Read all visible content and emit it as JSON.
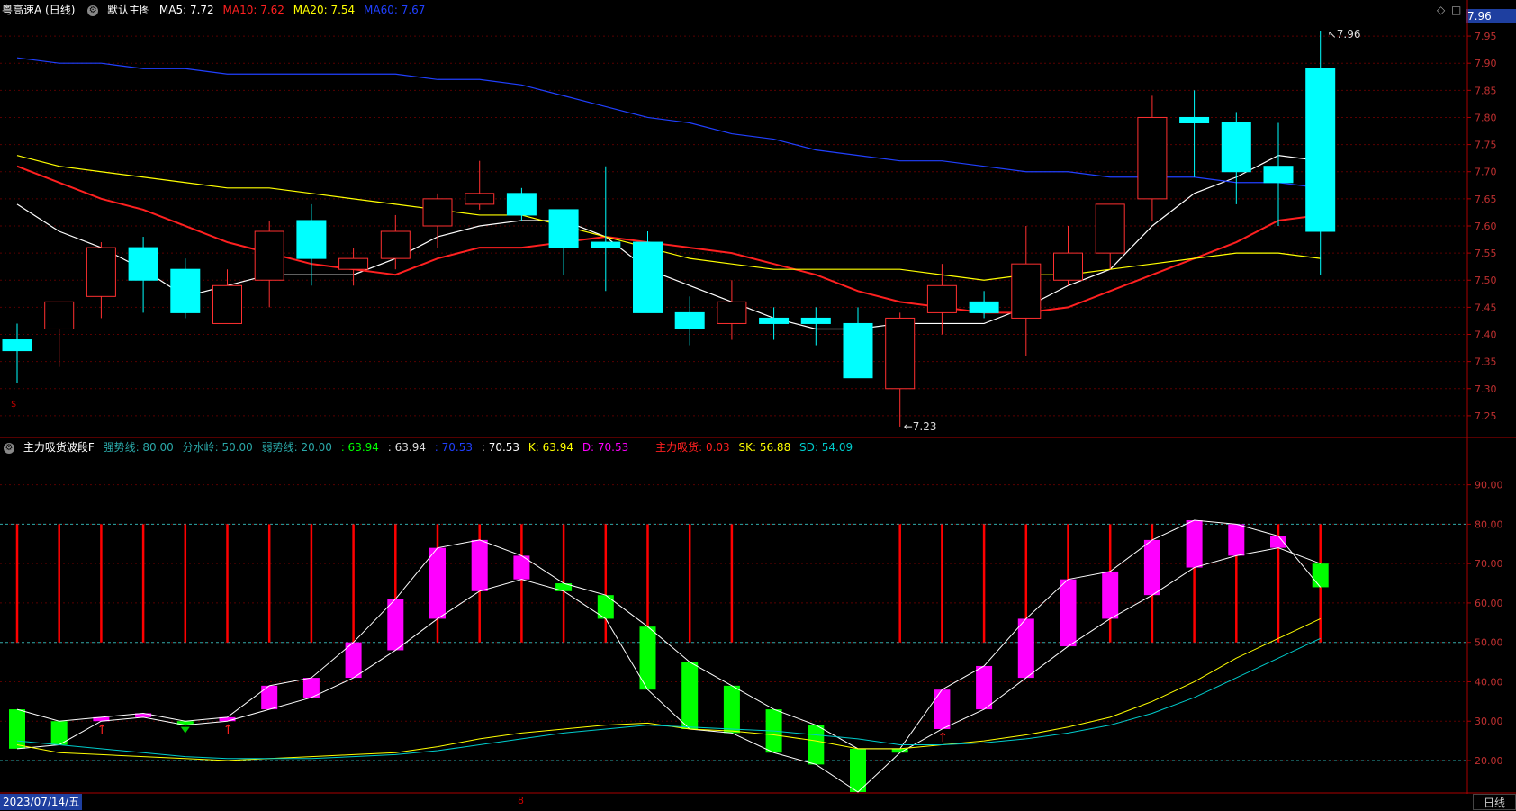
{
  "header": {
    "symbol": "粤高速A (日线)",
    "main_chart_label": "默认主图",
    "ma": [
      {
        "label": "MA5: 7.72",
        "color": "#ffffff"
      },
      {
        "label": "MA10: 7.62",
        "color": "#ff2020"
      },
      {
        "label": "MA20: 7.54",
        "color": "#ffff00"
      },
      {
        "label": "MA60: 7.67",
        "color": "#2040ff"
      }
    ],
    "current_price": "7.96"
  },
  "indicator_header": {
    "name": "主力吸货波段F",
    "items": [
      {
        "label": "强势线: 80.00",
        "color": "#2aa8a8"
      },
      {
        "label": "分水岭: 50.00",
        "color": "#2aa8a8"
      },
      {
        "label": "弱势线: 20.00",
        "color": "#2aa8a8"
      },
      {
        "label": ": 63.94",
        "color": "#00ff00"
      },
      {
        "label": ": 63.94",
        "color": "#dddddd"
      },
      {
        "label": ": 70.53",
        "color": "#2040ff"
      },
      {
        "label": ": 70.53",
        "color": "#ffffff"
      },
      {
        "label": "K: 63.94",
        "color": "#ffff00"
      },
      {
        "label": "D: 70.53",
        "color": "#ff00ff"
      },
      {
        "label": "主力吸货: 0.03",
        "color": "#ff2020"
      },
      {
        "label": "SK: 56.88",
        "color": "#ffff00"
      },
      {
        "label": "SD: 54.09",
        "color": "#00cccc"
      }
    ]
  },
  "footer": {
    "date": "2023/07/14/五",
    "cycle": "日线",
    "marker": "8"
  },
  "chart_data": [
    {
      "type": "candlestick",
      "title": "粤高速A (日线)",
      "y_ticks": [
        "7.95",
        "7.90",
        "7.85",
        "7.80",
        "7.75",
        "7.70",
        "7.65",
        "7.60",
        "7.55",
        "7.50",
        "7.45",
        "7.40",
        "7.35",
        "7.30",
        "7.25"
      ],
      "ylim": [
        7.21,
        7.98
      ],
      "annotations": {
        "high": "7.96",
        "low": "7.23"
      },
      "candles": [
        {
          "o": 7.39,
          "h": 7.42,
          "l": 7.31,
          "c": 7.37
        },
        {
          "o": 7.41,
          "h": 7.46,
          "l": 7.34,
          "c": 7.46
        },
        {
          "o": 7.47,
          "h": 7.57,
          "l": 7.43,
          "c": 7.56
        },
        {
          "o": 7.56,
          "h": 7.58,
          "l": 7.44,
          "c": 7.5
        },
        {
          "o": 7.52,
          "h": 7.54,
          "l": 7.43,
          "c": 7.44
        },
        {
          "o": 7.42,
          "h": 7.52,
          "l": 7.42,
          "c": 7.49
        },
        {
          "o": 7.5,
          "h": 7.61,
          "l": 7.45,
          "c": 7.59
        },
        {
          "o": 7.61,
          "h": 7.64,
          "l": 7.49,
          "c": 7.54
        },
        {
          "o": 7.52,
          "h": 7.56,
          "l": 7.49,
          "c": 7.54
        },
        {
          "o": 7.54,
          "h": 7.62,
          "l": 7.52,
          "c": 7.59
        },
        {
          "o": 7.6,
          "h": 7.66,
          "l": 7.56,
          "c": 7.65
        },
        {
          "o": 7.64,
          "h": 7.72,
          "l": 7.63,
          "c": 7.66
        },
        {
          "o": 7.66,
          "h": 7.67,
          "l": 7.61,
          "c": 7.62
        },
        {
          "o": 7.63,
          "h": 7.63,
          "l": 7.51,
          "c": 7.56
        },
        {
          "o": 7.57,
          "h": 7.71,
          "l": 7.48,
          "c": 7.56
        },
        {
          "o": 7.57,
          "h": 7.59,
          "l": 7.44,
          "c": 7.44
        },
        {
          "o": 7.44,
          "h": 7.47,
          "l": 7.38,
          "c": 7.41
        },
        {
          "o": 7.42,
          "h": 7.5,
          "l": 7.39,
          "c": 7.46
        },
        {
          "o": 7.43,
          "h": 7.45,
          "l": 7.39,
          "c": 7.42
        },
        {
          "o": 7.43,
          "h": 7.45,
          "l": 7.38,
          "c": 7.42
        },
        {
          "o": 7.42,
          "h": 7.45,
          "l": 7.32,
          "c": 7.32
        },
        {
          "o": 7.3,
          "h": 7.44,
          "l": 7.23,
          "c": 7.43
        },
        {
          "o": 7.44,
          "h": 7.53,
          "l": 7.4,
          "c": 7.49
        },
        {
          "o": 7.46,
          "h": 7.48,
          "l": 7.43,
          "c": 7.44
        },
        {
          "o": 7.43,
          "h": 7.6,
          "l": 7.36,
          "c": 7.53
        },
        {
          "o": 7.5,
          "h": 7.6,
          "l": 7.49,
          "c": 7.55
        },
        {
          "o": 7.55,
          "h": 7.64,
          "l": 7.52,
          "c": 7.64
        },
        {
          "o": 7.65,
          "h": 7.84,
          "l": 7.61,
          "c": 7.8
        },
        {
          "o": 7.8,
          "h": 7.85,
          "l": 7.69,
          "c": 7.79
        },
        {
          "o": 7.79,
          "h": 7.81,
          "l": 7.64,
          "c": 7.7
        },
        {
          "o": 7.71,
          "h": 7.79,
          "l": 7.6,
          "c": 7.68
        },
        {
          "o": 7.89,
          "h": 7.96,
          "l": 7.51,
          "c": 7.59
        }
      ],
      "lines": [
        {
          "name": "MA5",
          "color": "#ffffff",
          "values": [
            7.64,
            7.59,
            7.56,
            7.52,
            7.47,
            7.49,
            7.51,
            7.51,
            7.51,
            7.54,
            7.58,
            7.6,
            7.61,
            7.61,
            7.58,
            7.52,
            7.49,
            7.46,
            7.43,
            7.41,
            7.41,
            7.42,
            7.42,
            7.42,
            7.45,
            7.49,
            7.52,
            7.6,
            7.66,
            7.69,
            7.73,
            7.72
          ]
        },
        {
          "name": "MA10",
          "color": "#ff2020",
          "values": [
            7.71,
            7.68,
            7.65,
            7.63,
            7.6,
            7.57,
            7.55,
            7.53,
            7.52,
            7.51,
            7.54,
            7.56,
            7.56,
            7.57,
            7.58,
            7.57,
            7.56,
            7.55,
            7.53,
            7.51,
            7.48,
            7.46,
            7.45,
            7.44,
            7.44,
            7.45,
            7.48,
            7.51,
            7.54,
            7.57,
            7.61,
            7.62
          ]
        },
        {
          "name": "MA20",
          "color": "#ffff00",
          "values": [
            7.73,
            7.71,
            7.7,
            7.69,
            7.68,
            7.67,
            7.67,
            7.66,
            7.65,
            7.64,
            7.63,
            7.62,
            7.62,
            7.6,
            7.58,
            7.56,
            7.54,
            7.53,
            7.52,
            7.52,
            7.52,
            7.52,
            7.51,
            7.5,
            7.51,
            7.51,
            7.52,
            7.53,
            7.54,
            7.55,
            7.55,
            7.54
          ]
        },
        {
          "name": "MA60",
          "color": "#2040ff",
          "values": [
            7.91,
            7.9,
            7.9,
            7.89,
            7.89,
            7.88,
            7.88,
            7.88,
            7.88,
            7.88,
            7.87,
            7.87,
            7.86,
            7.84,
            7.82,
            7.8,
            7.79,
            7.77,
            7.76,
            7.74,
            7.73,
            7.72,
            7.72,
            7.71,
            7.7,
            7.7,
            7.69,
            7.69,
            7.69,
            7.68,
            7.68,
            7.67
          ]
        }
      ]
    },
    {
      "type": "bar",
      "title": "主力吸货波段F",
      "y_ticks": [
        "90.00",
        "80.00",
        "70.00",
        "60.00",
        "50.00",
        "40.00",
        "30.00",
        "20.00"
      ],
      "ylim": [
        12,
        97
      ],
      "reference_lines": [
        80,
        50,
        20
      ],
      "bars": [
        {
          "top": 33,
          "bottom": 23,
          "up": false
        },
        {
          "top": 30,
          "bottom": 24,
          "up": false
        },
        {
          "top": 31,
          "bottom": 30,
          "up": true,
          "arrow": true
        },
        {
          "top": 32,
          "bottom": 31,
          "up": true
        },
        {
          "top": 30,
          "bottom": 29,
          "up": false,
          "arrow": true
        },
        {
          "top": 31,
          "bottom": 30,
          "up": true,
          "arrow": true
        },
        {
          "top": 39,
          "bottom": 33,
          "up": true
        },
        {
          "top": 41,
          "bottom": 36,
          "up": true
        },
        {
          "top": 50,
          "bottom": 41,
          "up": true
        },
        {
          "top": 61,
          "bottom": 48,
          "up": true
        },
        {
          "top": 74,
          "bottom": 56,
          "up": true
        },
        {
          "top": 76,
          "bottom": 63,
          "up": true
        },
        {
          "top": 72,
          "bottom": 66,
          "up": true
        },
        {
          "top": 65,
          "bottom": 63,
          "up": false
        },
        {
          "top": 62,
          "bottom": 56,
          "up": false
        },
        {
          "top": 54,
          "bottom": 38,
          "up": false
        },
        {
          "top": 45,
          "bottom": 28,
          "up": false
        },
        {
          "top": 39,
          "bottom": 27,
          "up": false
        },
        {
          "top": 33,
          "bottom": 22,
          "up": false
        },
        {
          "top": 29,
          "bottom": 19,
          "up": false
        },
        {
          "top": 23,
          "bottom": 12,
          "up": false
        },
        {
          "top": 23,
          "bottom": 22,
          "up": false
        },
        {
          "top": 38,
          "bottom": 28,
          "up": true,
          "arrow": true
        },
        {
          "top": 44,
          "bottom": 33,
          "up": true
        },
        {
          "top": 56,
          "bottom": 41,
          "up": true
        },
        {
          "top": 66,
          "bottom": 49,
          "up": true
        },
        {
          "top": 68,
          "bottom": 56,
          "up": true
        },
        {
          "top": 76,
          "bottom": 62,
          "up": true
        },
        {
          "top": 81,
          "bottom": 69,
          "up": true
        },
        {
          "top": 80,
          "bottom": 72,
          "up": true
        },
        {
          "top": 77,
          "bottom": 74,
          "up": true
        },
        {
          "top": 70,
          "bottom": 64,
          "up": false
        }
      ],
      "red_spikes_indices": [
        0,
        1,
        2,
        3,
        4,
        5,
        6,
        7,
        8,
        9,
        10,
        11,
        12,
        13,
        14,
        15,
        16,
        17,
        21,
        22,
        23,
        24,
        25,
        26,
        27,
        28,
        29,
        30,
        31
      ],
      "lines": [
        {
          "name": "K",
          "color": "#ffffff",
          "values": [
            33,
            30,
            31,
            32,
            30,
            31,
            39,
            41,
            50,
            61,
            74,
            76,
            72,
            65,
            62,
            54,
            45,
            39,
            33,
            29,
            23,
            23,
            38,
            44,
            56,
            66,
            68,
            76,
            81,
            80,
            77,
            64
          ]
        },
        {
          "name": "D",
          "color": "#ffffff",
          "values": [
            23,
            24,
            30,
            31,
            29,
            30,
            33,
            36,
            41,
            48,
            56,
            63,
            66,
            63,
            56,
            38,
            28,
            27,
            22,
            19,
            12,
            22,
            28,
            33,
            41,
            49,
            56,
            62,
            69,
            72,
            74,
            70
          ]
        },
        {
          "name": "SK",
          "color": "#ffff00",
          "values": [
            24,
            22,
            21.5,
            21,
            20.5,
            20,
            20.5,
            21,
            21.5,
            22,
            23.5,
            25.5,
            27,
            28,
            29,
            29.5,
            28,
            27.5,
            26.5,
            25,
            23,
            23,
            24,
            25,
            26.5,
            28.5,
            31,
            35,
            40,
            46,
            51,
            56
          ]
        },
        {
          "name": "SD",
          "color": "#00cccc",
          "values": [
            25,
            24,
            23,
            22,
            21,
            20.5,
            20.5,
            20.5,
            21,
            21.5,
            22.5,
            24,
            25.5,
            27,
            28,
            29,
            28.5,
            28,
            27.5,
            26.5,
            25.5,
            24,
            24,
            24.5,
            25.5,
            27,
            29,
            32,
            36,
            41,
            46,
            51
          ]
        }
      ]
    }
  ]
}
